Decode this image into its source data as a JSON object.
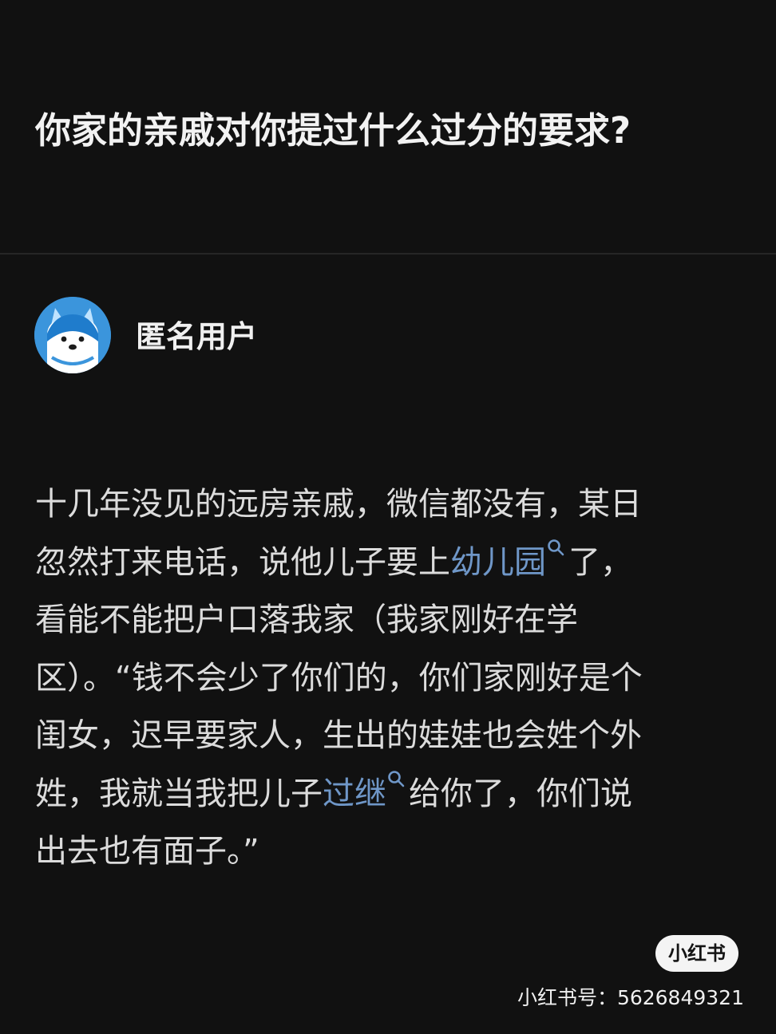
{
  "question": {
    "title": "你家的亲戚对你提过什么过分的要求?"
  },
  "author": {
    "name": "匿名用户",
    "avatar_icon": "anonymous-avatar-icon"
  },
  "answer": {
    "line1": "十几年没见的远房亲戚，微信都没有，某日",
    "line2_before": "忽然打来电话，说他儿子要上",
    "line2_keyword": "幼儿园",
    "line2_after": "了，",
    "line3": "看能不能把户口落我家（我家刚好在学",
    "line4": "区）。“钱不会少了你们的，你们家刚好是个",
    "line5": "闺女，迟早要家人，生出的娃娃也会姓个外",
    "line6_before": "姓，我就当我把儿子",
    "line6_keyword": "过继",
    "line6_after": "给你了，你们说",
    "line7": "出去也有面子。”",
    "keyword_color": "#6f97c8",
    "search_icon": "search-icon"
  },
  "watermark": {
    "logo_text": "小红书",
    "id_text": "小红书号：5626849321"
  }
}
